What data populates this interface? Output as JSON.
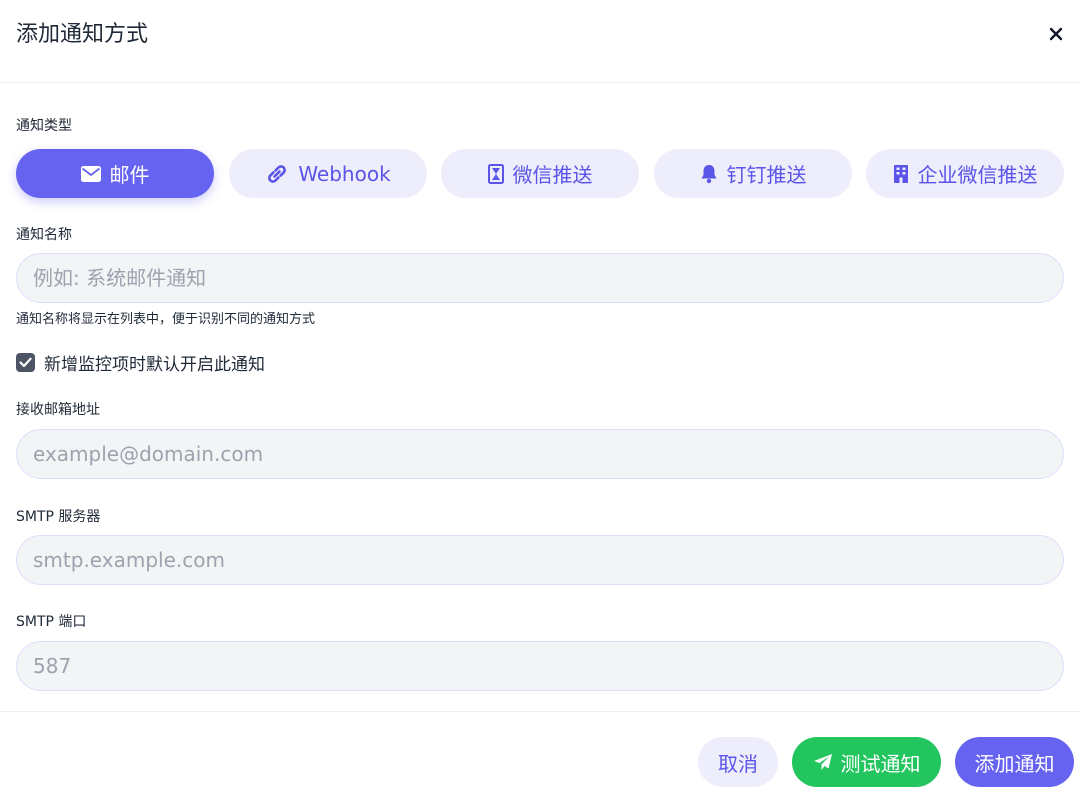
{
  "dialog": {
    "title": "添加通知方式",
    "close_symbol": "×"
  },
  "type_section": {
    "label": "通知类型",
    "tabs": [
      {
        "label": "邮件",
        "icon": "envelope-icon",
        "active": true
      },
      {
        "label": "Webhook",
        "icon": "link-icon",
        "active": false
      },
      {
        "label": "微信推送",
        "icon": "hourglass-icon",
        "active": false
      },
      {
        "label": "钉钉推送",
        "icon": "bell-icon",
        "active": false
      },
      {
        "label": "企业微信推送",
        "icon": "building-icon",
        "active": false
      }
    ]
  },
  "name_field": {
    "label": "通知名称",
    "placeholder": "例如: 系统邮件通知",
    "value": "",
    "hint": "通知名称将显示在列表中，便于识别不同的通知方式"
  },
  "default_enable": {
    "label": "新增监控项时默认开启此通知",
    "checked": true
  },
  "email_field": {
    "label": "接收邮箱地址",
    "placeholder": "example@domain.com",
    "value": ""
  },
  "smtp_server_field": {
    "label": "SMTP 服务器",
    "placeholder": "smtp.example.com",
    "value": ""
  },
  "smtp_port_field": {
    "label": "SMTP 端口",
    "placeholder": "587",
    "value": ""
  },
  "footer": {
    "cancel_label": "取消",
    "test_label": "测试通知",
    "add_label": "添加通知"
  },
  "colors": {
    "accent": "#6663f1",
    "accent_soft": "#eeedfb",
    "success": "#22c55e",
    "input_bg": "#f3f4f6"
  }
}
